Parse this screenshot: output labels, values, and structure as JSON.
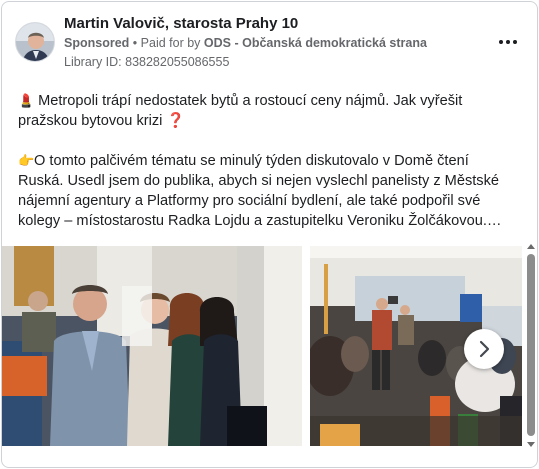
{
  "post": {
    "author": "Martin Valovič, starosta Prahy 10",
    "sponsored": "Sponsored",
    "separator": "•",
    "paid_for_by": "Paid for by",
    "advertiser": "ODS - Občanská demokratická strana",
    "library_id": "Library ID: 838282055086555",
    "paragraph1_emoji": "💄",
    "paragraph1": "Metropoli trápí nedostatek bytů a rostoucí ceny nájmů. Jak vyřešit pražskou bytovou krizi",
    "paragraph1_end_emoji": "❓",
    "paragraph2_emoji": "👉",
    "paragraph2": "O tomto palčivém tématu se minulý týden diskutovalo v Domě čtení Ruská. Usedl jsem do publika, abych si nejen vyslechl panelisty z Městské nájemní agentury a Platformy pro sociální bydlení, ale také podpořil své kolegy – místostarostu Radka Lojdu a zastupitelku Veroniku Žolčákovou.…"
  },
  "icons": {
    "more": "more-horizontal-icon",
    "next": "chevron-right-icon"
  },
  "colors": {
    "text_primary": "#1c1e21",
    "text_secondary": "#65676b",
    "border": "#cfd3d8"
  }
}
